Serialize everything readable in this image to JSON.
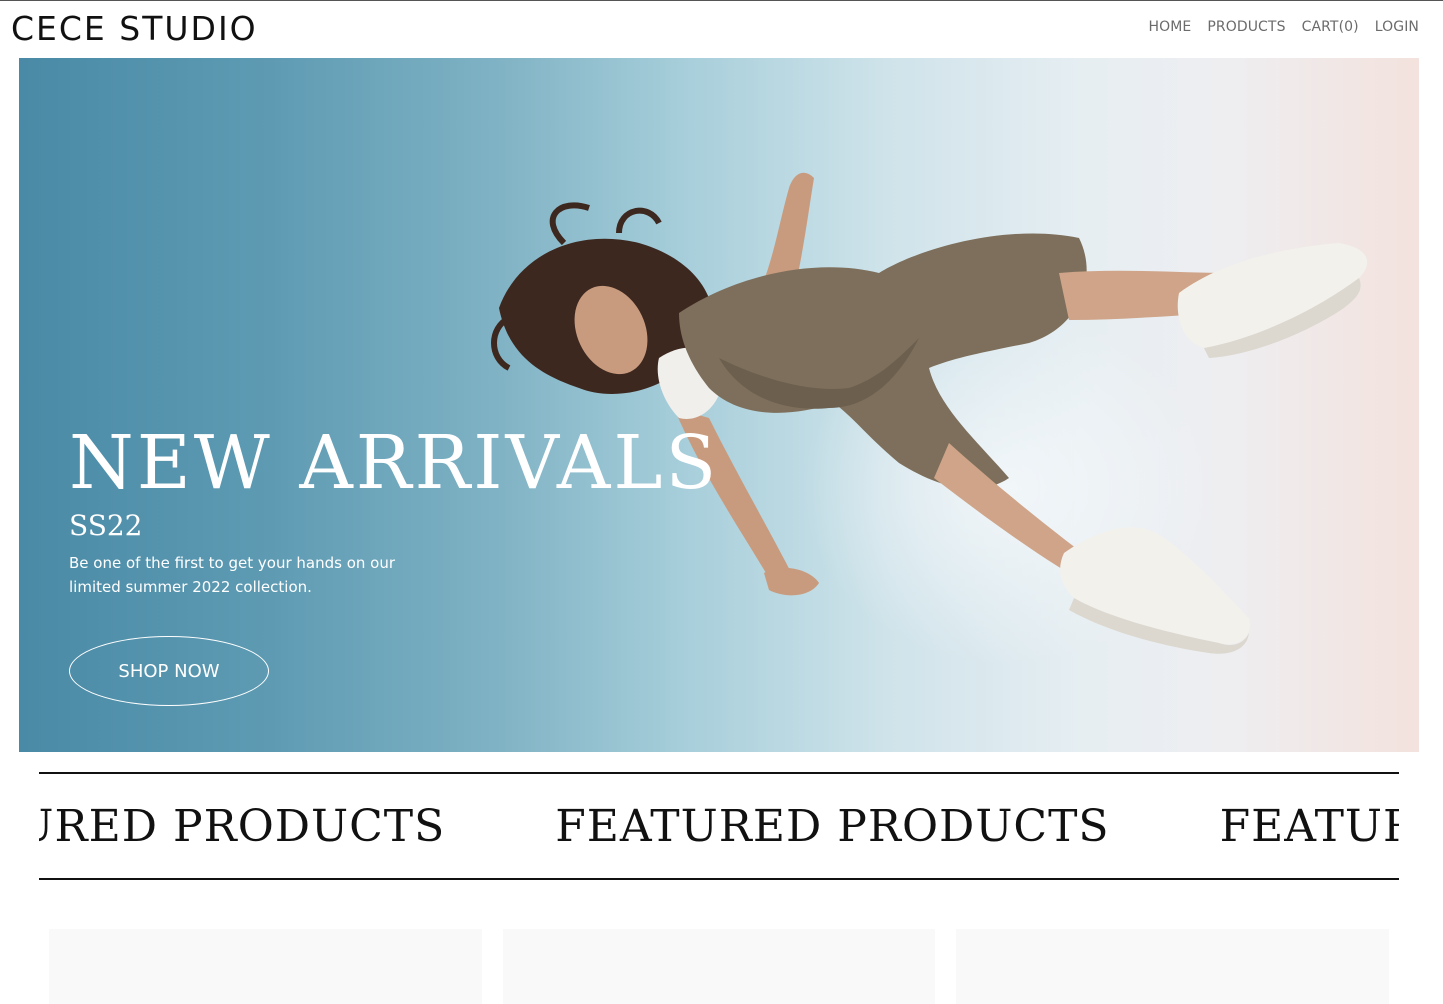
{
  "header": {
    "logo": "CECE STUDIO",
    "nav": [
      {
        "label": "HOME"
      },
      {
        "label": "PRODUCTS"
      },
      {
        "label": "CART(0)"
      },
      {
        "label": "LOGIN"
      }
    ]
  },
  "hero": {
    "title": "NEW ARRIVALS",
    "subtitle": "SS22",
    "description": "Be one of the first to get your hands on our limited summer 2022 collection.",
    "cta_label": "SHOP NOW"
  },
  "featured": {
    "heading_items": [
      "FEATURED PRODUCTS",
      "FEATURED PRODUCTS",
      "FEATURED PRODUCTS"
    ]
  },
  "products": {
    "cards": [
      {},
      {},
      {}
    ]
  },
  "colors": {
    "hero_gradient_left": "#4a8aa6",
    "hero_gradient_right": "#f3e2dd",
    "text_dark": "#111111",
    "nav_text": "#6b6b6b",
    "card_bg": "#f9f9f9"
  }
}
